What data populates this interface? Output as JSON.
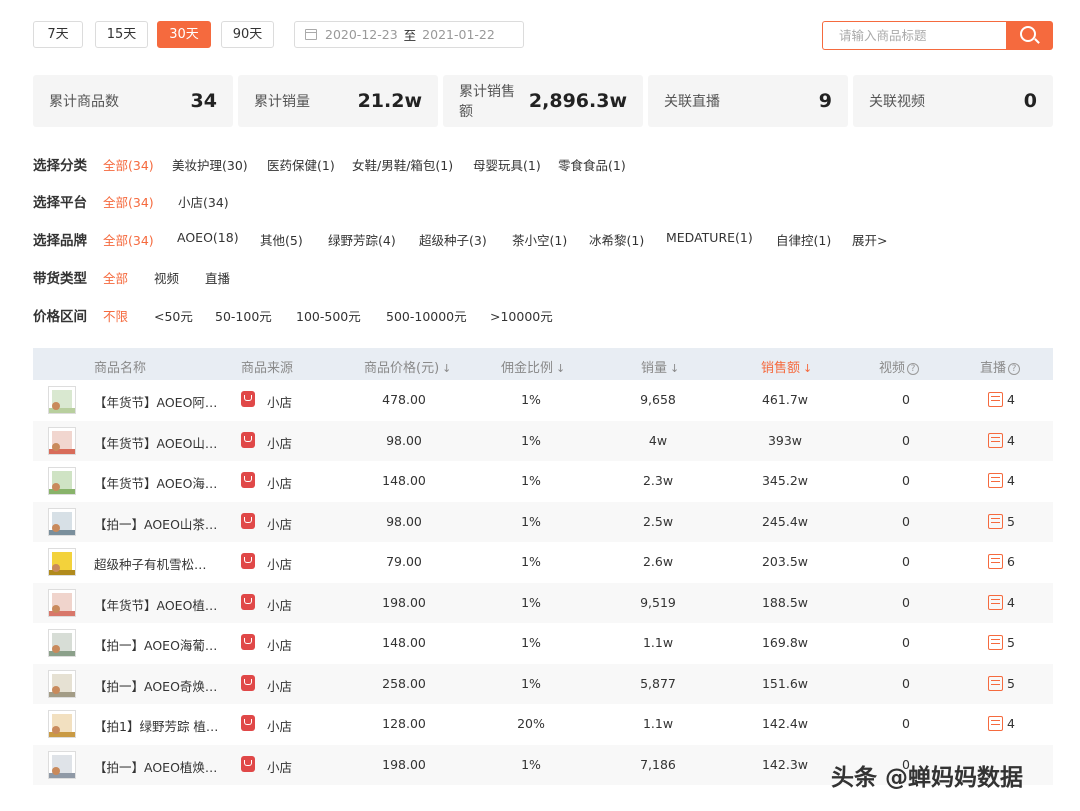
{
  "toolbar": {
    "ranges": [
      {
        "label": "7天",
        "active": false
      },
      {
        "label": "15天",
        "active": false
      },
      {
        "label": "30天",
        "active": true
      },
      {
        "label": "90天",
        "active": false
      }
    ],
    "date_start": "2020-12-23",
    "date_sep": "至",
    "date_end": "2021-01-22",
    "search_placeholder": "请输入商品标题"
  },
  "stats": [
    {
      "label": "累计商品数",
      "value": "34"
    },
    {
      "label": "累计销量",
      "value": "21.2w"
    },
    {
      "label": "累计销售额",
      "value": "2,896.3w"
    },
    {
      "label": "关联直播",
      "value": "9"
    },
    {
      "label": "关联视频",
      "value": "0"
    }
  ],
  "filters": [
    {
      "title": "选择分类",
      "options": [
        "全部(34)",
        "美妆护理(30)",
        "医药保健(1)",
        "女鞋/男鞋/箱包(1)",
        "母婴玩具(1)",
        "零食食品(1)"
      ],
      "active": 0
    },
    {
      "title": "选择平台",
      "options": [
        "全部(34)",
        "小店(34)"
      ],
      "active": 0
    },
    {
      "title": "选择品牌",
      "options": [
        "全部(34)",
        "AOEO(18)",
        "其他(5)",
        "绿野芳踪(4)",
        "超级种子(3)",
        "茶小空(1)",
        "冰希黎(1)",
        "MEDATURE(1)",
        "自律控(1)",
        "展开>"
      ],
      "active": 0
    },
    {
      "title": "带货类型",
      "options": [
        "全部",
        "视频",
        "直播"
      ],
      "active": 0
    },
    {
      "title": "价格区间",
      "options": [
        "不限",
        "<50元",
        "50-100元",
        "100-500元",
        "500-10000元",
        ">10000元"
      ],
      "active": 0
    }
  ],
  "table": {
    "headers": {
      "name": "商品名称",
      "source": "商品来源",
      "price": "商品价格(元)",
      "commission": "佣金比例",
      "sales": "销量",
      "revenue": "销售额",
      "video": "视频",
      "live": "直播"
    },
    "sort_arrow": "↓",
    "rows": [
      {
        "name": "【年货节】AOEO阿…",
        "source": "小店",
        "price": "478.00",
        "commission": "1%",
        "sales": "9,658",
        "revenue": "461.7w",
        "video": "0",
        "live": "4"
      },
      {
        "name": "【年货节】AOEO山…",
        "source": "小店",
        "price": "98.00",
        "commission": "1%",
        "sales": "4w",
        "revenue": "393w",
        "video": "0",
        "live": "4"
      },
      {
        "name": "【年货节】AOEO海…",
        "source": "小店",
        "price": "148.00",
        "commission": "1%",
        "sales": "2.3w",
        "revenue": "345.2w",
        "video": "0",
        "live": "4"
      },
      {
        "name": "【拍一】AOEO山茶…",
        "source": "小店",
        "price": "98.00",
        "commission": "1%",
        "sales": "2.5w",
        "revenue": "245.4w",
        "video": "0",
        "live": "5"
      },
      {
        "name": "超级种子有机雪松…",
        "source": "小店",
        "price": "79.00",
        "commission": "1%",
        "sales": "2.6w",
        "revenue": "203.5w",
        "video": "0",
        "live": "6"
      },
      {
        "name": "【年货节】AOEO植…",
        "source": "小店",
        "price": "198.00",
        "commission": "1%",
        "sales": "9,519",
        "revenue": "188.5w",
        "video": "0",
        "live": "4"
      },
      {
        "name": "【拍一】AOEO海葡…",
        "source": "小店",
        "price": "148.00",
        "commission": "1%",
        "sales": "1.1w",
        "revenue": "169.8w",
        "video": "0",
        "live": "5"
      },
      {
        "name": "【拍一】AOEO奇焕…",
        "source": "小店",
        "price": "258.00",
        "commission": "1%",
        "sales": "5,877",
        "revenue": "151.6w",
        "video": "0",
        "live": "5"
      },
      {
        "name": "【拍1】绿野芳踪 植…",
        "source": "小店",
        "price": "128.00",
        "commission": "20%",
        "sales": "1.1w",
        "revenue": "142.4w",
        "video": "0",
        "live": "4"
      },
      {
        "name": "【拍一】AOEO植焕…",
        "source": "小店",
        "price": "198.00",
        "commission": "1%",
        "sales": "7,186",
        "revenue": "142.3w",
        "video": "0",
        "live": ""
      }
    ]
  },
  "watermark": "头条 @蝉妈妈数据",
  "colors": {
    "accent": "#f56a3e",
    "header_bg": "#e8edf3",
    "card_bg": "#f5f5f5",
    "shop_red": "#e04848"
  }
}
